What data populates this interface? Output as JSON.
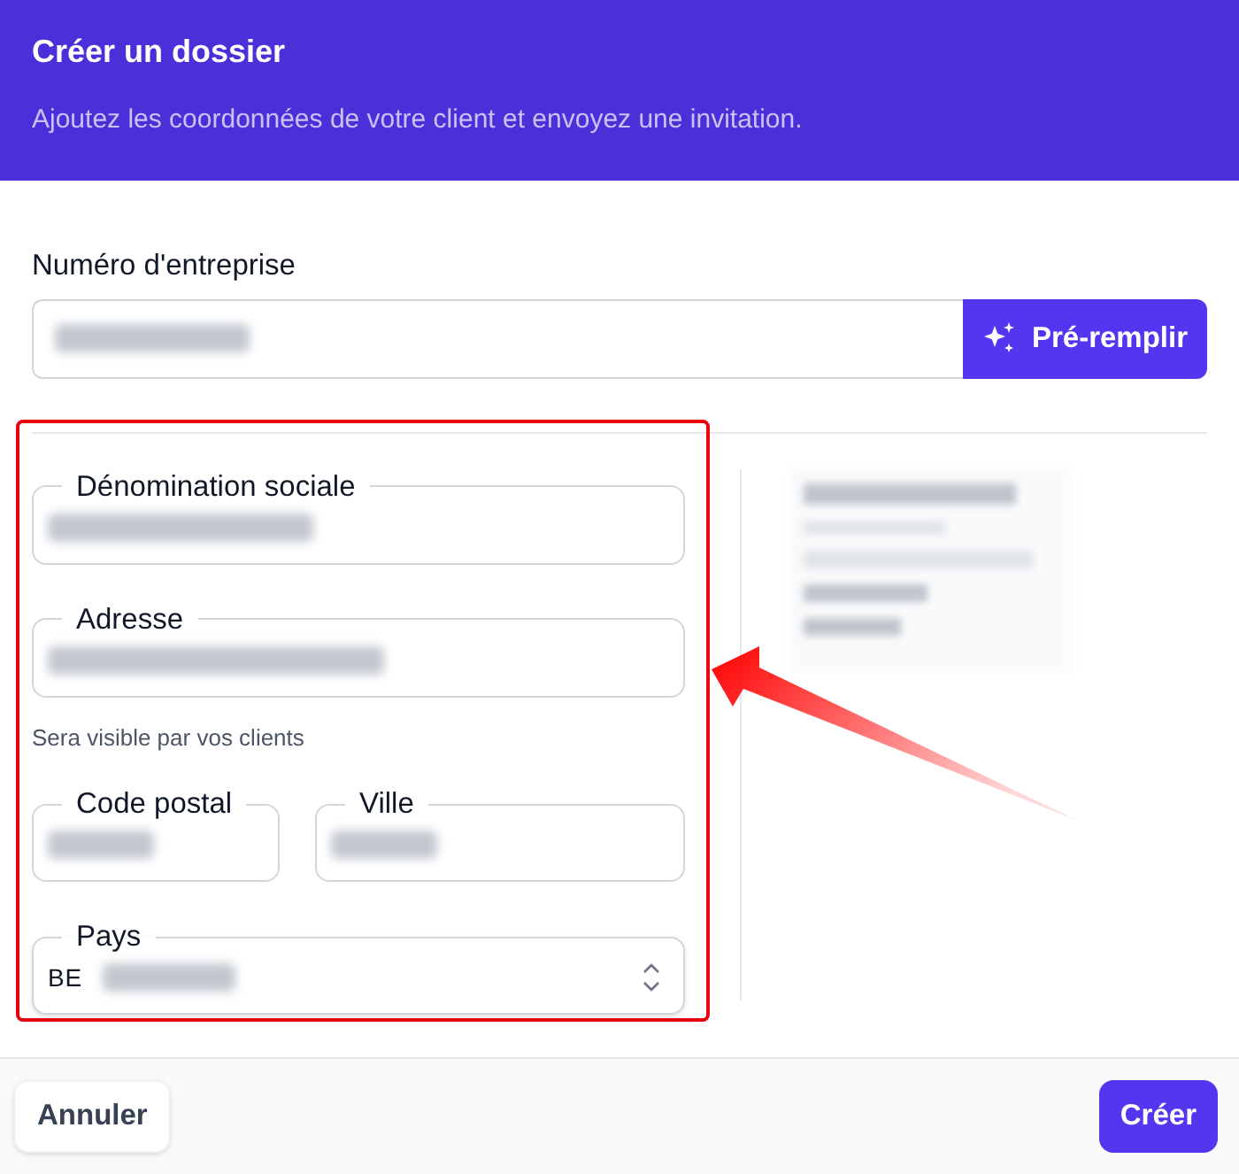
{
  "header": {
    "title": "Créer un dossier",
    "subtitle": "Ajoutez les coordonnées de votre client et envoyez une invitation."
  },
  "company_number": {
    "label": "Numéro d'entreprise",
    "redacted": true,
    "button": "Pré-remplir"
  },
  "fields": [
    {
      "kind": "text",
      "label": "Dénomination sociale",
      "redacted": true
    },
    {
      "kind": "text",
      "label": "Adresse",
      "redacted": true,
      "help": "Sera visible par vos clients"
    }
  ],
  "city_fields": [
    {
      "label": "Code postal",
      "redacted": true
    },
    {
      "label": "Ville",
      "redacted": true
    }
  ],
  "country": {
    "label": "Pays",
    "code": "BE",
    "redacted": true
  },
  "summary": {
    "redacted": true
  },
  "footer": {
    "cancel": "Annuler",
    "submit": "Créer"
  }
}
